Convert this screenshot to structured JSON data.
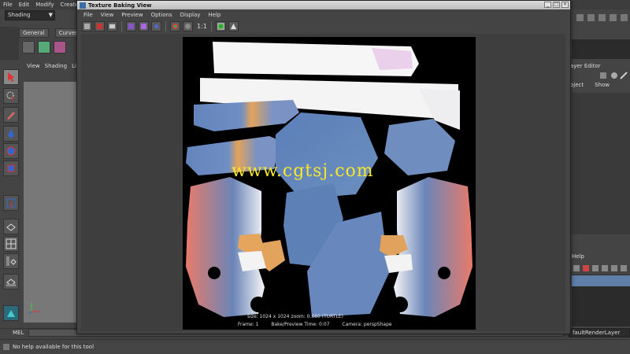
{
  "app_menu": [
    "File",
    "Edit",
    "Modify",
    "Create"
  ],
  "shading_select": {
    "value": "Shading"
  },
  "shelf_tabs": [
    "General",
    "Curves"
  ],
  "viewport_menu": [
    "View",
    "Shading",
    "Li"
  ],
  "texture_baking_window": {
    "title": "Texture Baking View",
    "menu": [
      "File",
      "View",
      "Preview",
      "Options",
      "Display",
      "Help"
    ],
    "toolbar_ratio_label": "1:1",
    "watermark": "www.cgtsj.com",
    "hud": {
      "line1": "size: 1024 x 1024 zoom: 0.580       (TURTLE)",
      "frame": "Frame: 1",
      "bake_time": "Bake/Preview Time: 0:07",
      "camera": "Camera: perspShape"
    }
  },
  "layer_editor": {
    "title": "ayer Editor",
    "tabs": [
      "oject",
      "Show"
    ]
  },
  "render_panel": {
    "help_label": "Help",
    "layer_field": "faultRenderLayer"
  },
  "command_line": {
    "label": "MEL"
  },
  "help_line": {
    "text": "No help available for this tool"
  },
  "colors": {
    "background": "#444444",
    "viewport_gray": "#787878",
    "selection_blue": "#5f7fa8",
    "watermark_yellow": "#f6e72b"
  }
}
